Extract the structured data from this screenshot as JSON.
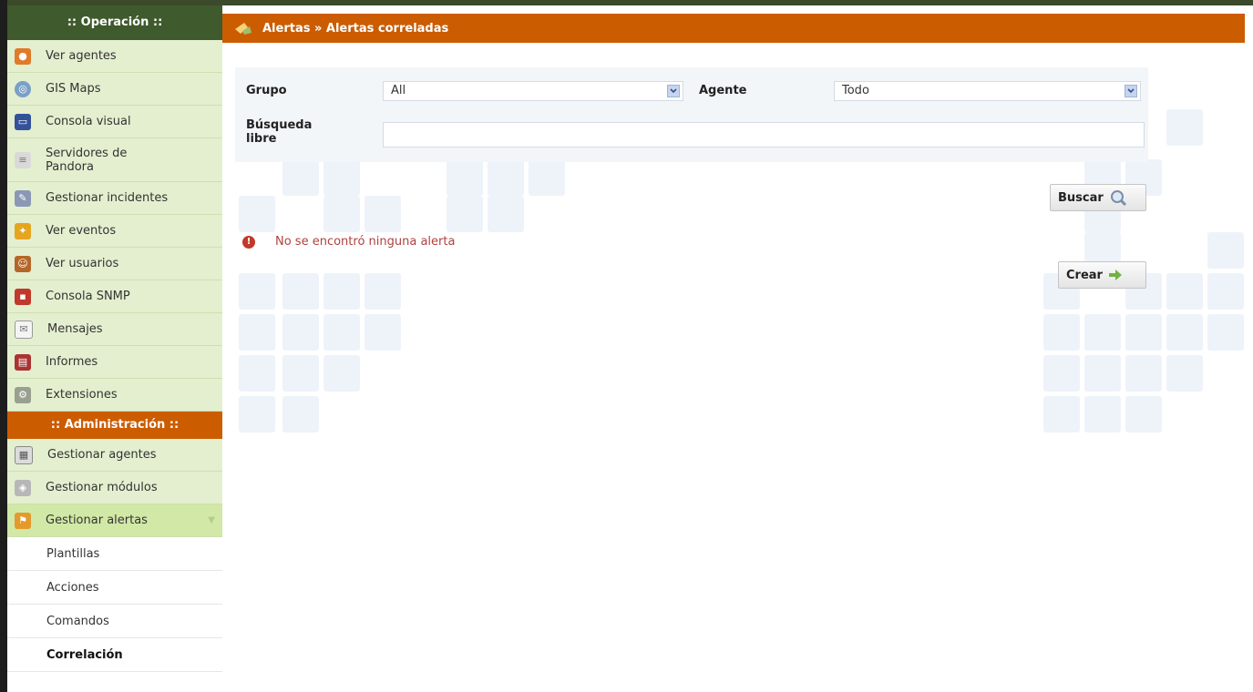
{
  "sidebar": {
    "operation_header": ":: Operación ::",
    "operation_items": [
      {
        "label": "Ver agentes",
        "icon": "agents-icon"
      },
      {
        "label": "GIS Maps",
        "icon": "globe-icon"
      },
      {
        "label": "Consola visual",
        "icon": "monitor-icon"
      },
      {
        "label": "Servidores de Pandora",
        "icon": "server-icon"
      },
      {
        "label": "Gestionar incidentes",
        "icon": "incident-icon"
      },
      {
        "label": "Ver eventos",
        "icon": "events-icon"
      },
      {
        "label": "Ver usuarios",
        "icon": "users-icon"
      },
      {
        "label": "Consola SNMP",
        "icon": "snmp-icon"
      },
      {
        "label": "Mensajes",
        "icon": "mail-icon"
      },
      {
        "label": "Informes",
        "icon": "reports-icon"
      },
      {
        "label": "Extensiones",
        "icon": "extensions-icon"
      }
    ],
    "admin_header": ":: Administración ::",
    "admin_items": [
      {
        "label": "Gestionar agentes",
        "icon": "manage-agents-icon"
      },
      {
        "label": "Gestionar módulos",
        "icon": "modules-icon"
      },
      {
        "label": "Gestionar alertas",
        "icon": "alerts-icon"
      }
    ],
    "alert_subitems": [
      "Plantillas",
      "Acciones",
      "Comandos",
      "Correlación"
    ]
  },
  "header": {
    "title": "Alertas » Alertas correladas"
  },
  "filter": {
    "group_label": "Grupo",
    "group_value": "All",
    "agent_label": "Agente",
    "agent_value": "Todo",
    "search_label": "Búsqueda libre",
    "search_value": ""
  },
  "buttons": {
    "search": "Buscar",
    "create": "Crear"
  },
  "message": "No se encontró ninguna alerta",
  "colors": {
    "orange": "#cc5c00",
    "dark_green": "#3f5a2c",
    "menu_bg": "#e4efcf",
    "error": "#b0413e"
  }
}
